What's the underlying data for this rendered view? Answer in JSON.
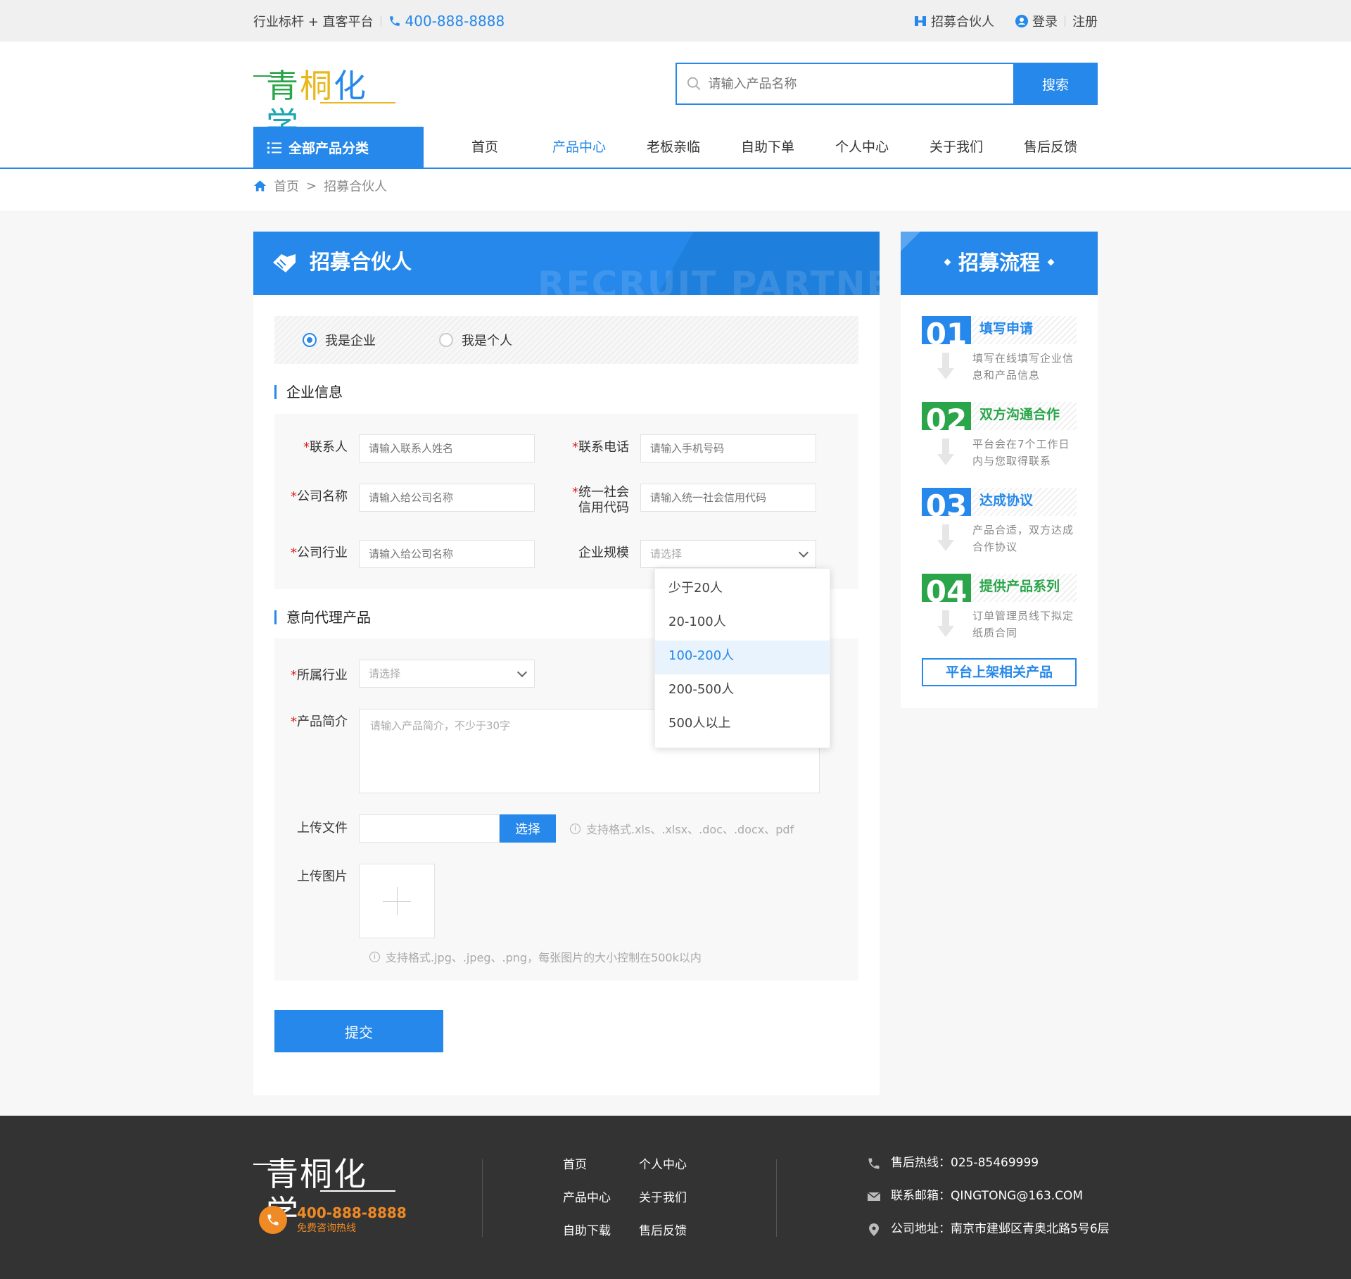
{
  "topbar": {
    "slogan": "行业标杆 + 直客平台",
    "phone": "400-888-8888",
    "recruit_link": "招募合伙人",
    "login": "登录",
    "register": "注册"
  },
  "header": {
    "logo_chars": [
      "青",
      "桐",
      "化",
      "学"
    ],
    "search_placeholder": "请输入产品名称",
    "search_button": "搜索"
  },
  "nav": {
    "category_label": "全部产品分类",
    "items": [
      "首页",
      "产品中心",
      "老板亲临",
      "自助下单",
      "个人中心",
      "关于我们",
      "售后反馈"
    ],
    "active_index": 1
  },
  "breadcrumb": {
    "home": "首页",
    "separator": ">",
    "current": "招募合伙人"
  },
  "form": {
    "title": "招募合伙人",
    "watermark": "RECRUIT PARTNERS",
    "radio_company": "我是企业",
    "radio_personal": "我是个人",
    "selected_type": "company",
    "section_company": "企业信息",
    "contact_label": "联系人",
    "contact_placeholder": "请输入联系人姓名",
    "phone_label": "联系电话",
    "phone_placeholder": "请输入手机号码",
    "company_label": "公司名称",
    "company_placeholder": "请输入给公司名称",
    "credit_label_1": "统一社会",
    "credit_label_2": "信用代码",
    "credit_placeholder": "请输入统一社会信用代码",
    "industry_label": "公司行业",
    "industry_placeholder": "请输入给公司名称",
    "scale_label": "企业规模",
    "scale_placeholder": "请选择",
    "scale_options": [
      "少于20人",
      "20-100人",
      "100-200人",
      "200-500人",
      "500人以上"
    ],
    "scale_highlighted_index": 2,
    "section_product": "意向代理产品",
    "sector_label": "所属行业",
    "sector_placeholder": "请选择",
    "intro_label": "产品简介",
    "intro_placeholder": "请输入产品简介，不少于30字",
    "upload_file_label": "上传文件",
    "upload_file_button": "选择",
    "upload_file_hint": "支持格式.xls、.xlsx、.doc、.docx、pdf",
    "upload_image_label": "上传图片",
    "upload_image_hint": "支持格式.jpg、.jpeg、.png，每张图片的大小控制在500k以内",
    "submit": "提交",
    "required_mark": "*"
  },
  "process": {
    "title": "招募流程",
    "steps": [
      {
        "num": "01",
        "title": "填写申请",
        "desc": "填写在线填写企业信息和产品信息",
        "color": "#2588ea"
      },
      {
        "num": "02",
        "title": "双方沟通合作",
        "desc": "平台会在7个工作日内与您取得联系",
        "color": "#2aa54a"
      },
      {
        "num": "03",
        "title": "达成协议",
        "desc": "产品合适，双方达成合作协议",
        "color": "#2588ea"
      },
      {
        "num": "04",
        "title": "提供产品系列",
        "desc": "订单管理员线下拟定纸质合同",
        "color": "#2aa54a"
      }
    ],
    "button": "平台上架相关产品"
  },
  "footer": {
    "hotline_number": "400-888-8888",
    "hotline_sub": "免费咨询热线",
    "links": [
      "首页",
      "个人中心",
      "产品中心",
      "关于我们",
      "自助下载",
      "售后反馈"
    ],
    "service_phone": "售后热线：025-85469999",
    "email": "联系邮箱：QINGTONG@163.COM",
    "address": "公司地址：南京市建邺区青奥北路5号6层"
  },
  "colors": {
    "accent": "#2588ea",
    "green": "#2aa54a",
    "orange": "#f08a24",
    "footer_bg": "#333333"
  }
}
